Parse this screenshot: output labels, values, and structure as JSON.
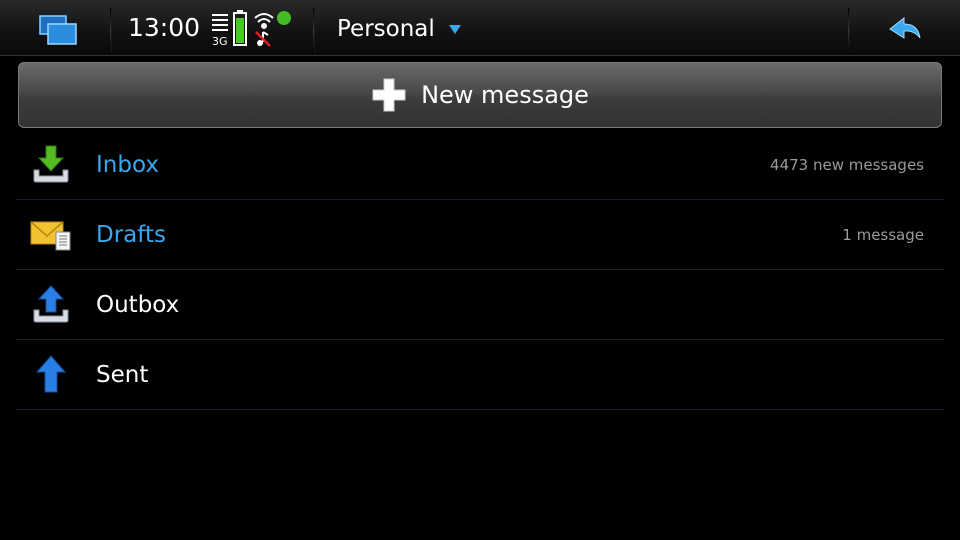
{
  "status_bar": {
    "time": "13:00",
    "network_type": "3G"
  },
  "header": {
    "account": "Personal"
  },
  "new_message": {
    "label": "New message"
  },
  "folders": [
    {
      "name": "Inbox",
      "count": "4473 new messages",
      "icon": "inbox-download-icon",
      "unread": true
    },
    {
      "name": "Drafts",
      "count": "1 message",
      "icon": "envelope-drafts-icon",
      "unread": true
    },
    {
      "name": "Outbox",
      "count": "",
      "icon": "outbox-upload-icon",
      "unread": false
    },
    {
      "name": "Sent",
      "count": "",
      "icon": "sent-arrow-icon",
      "unread": false
    }
  ],
  "colors": {
    "accent": "#3aa8ee",
    "background": "#000000",
    "count_text": "#9a9a9a"
  }
}
